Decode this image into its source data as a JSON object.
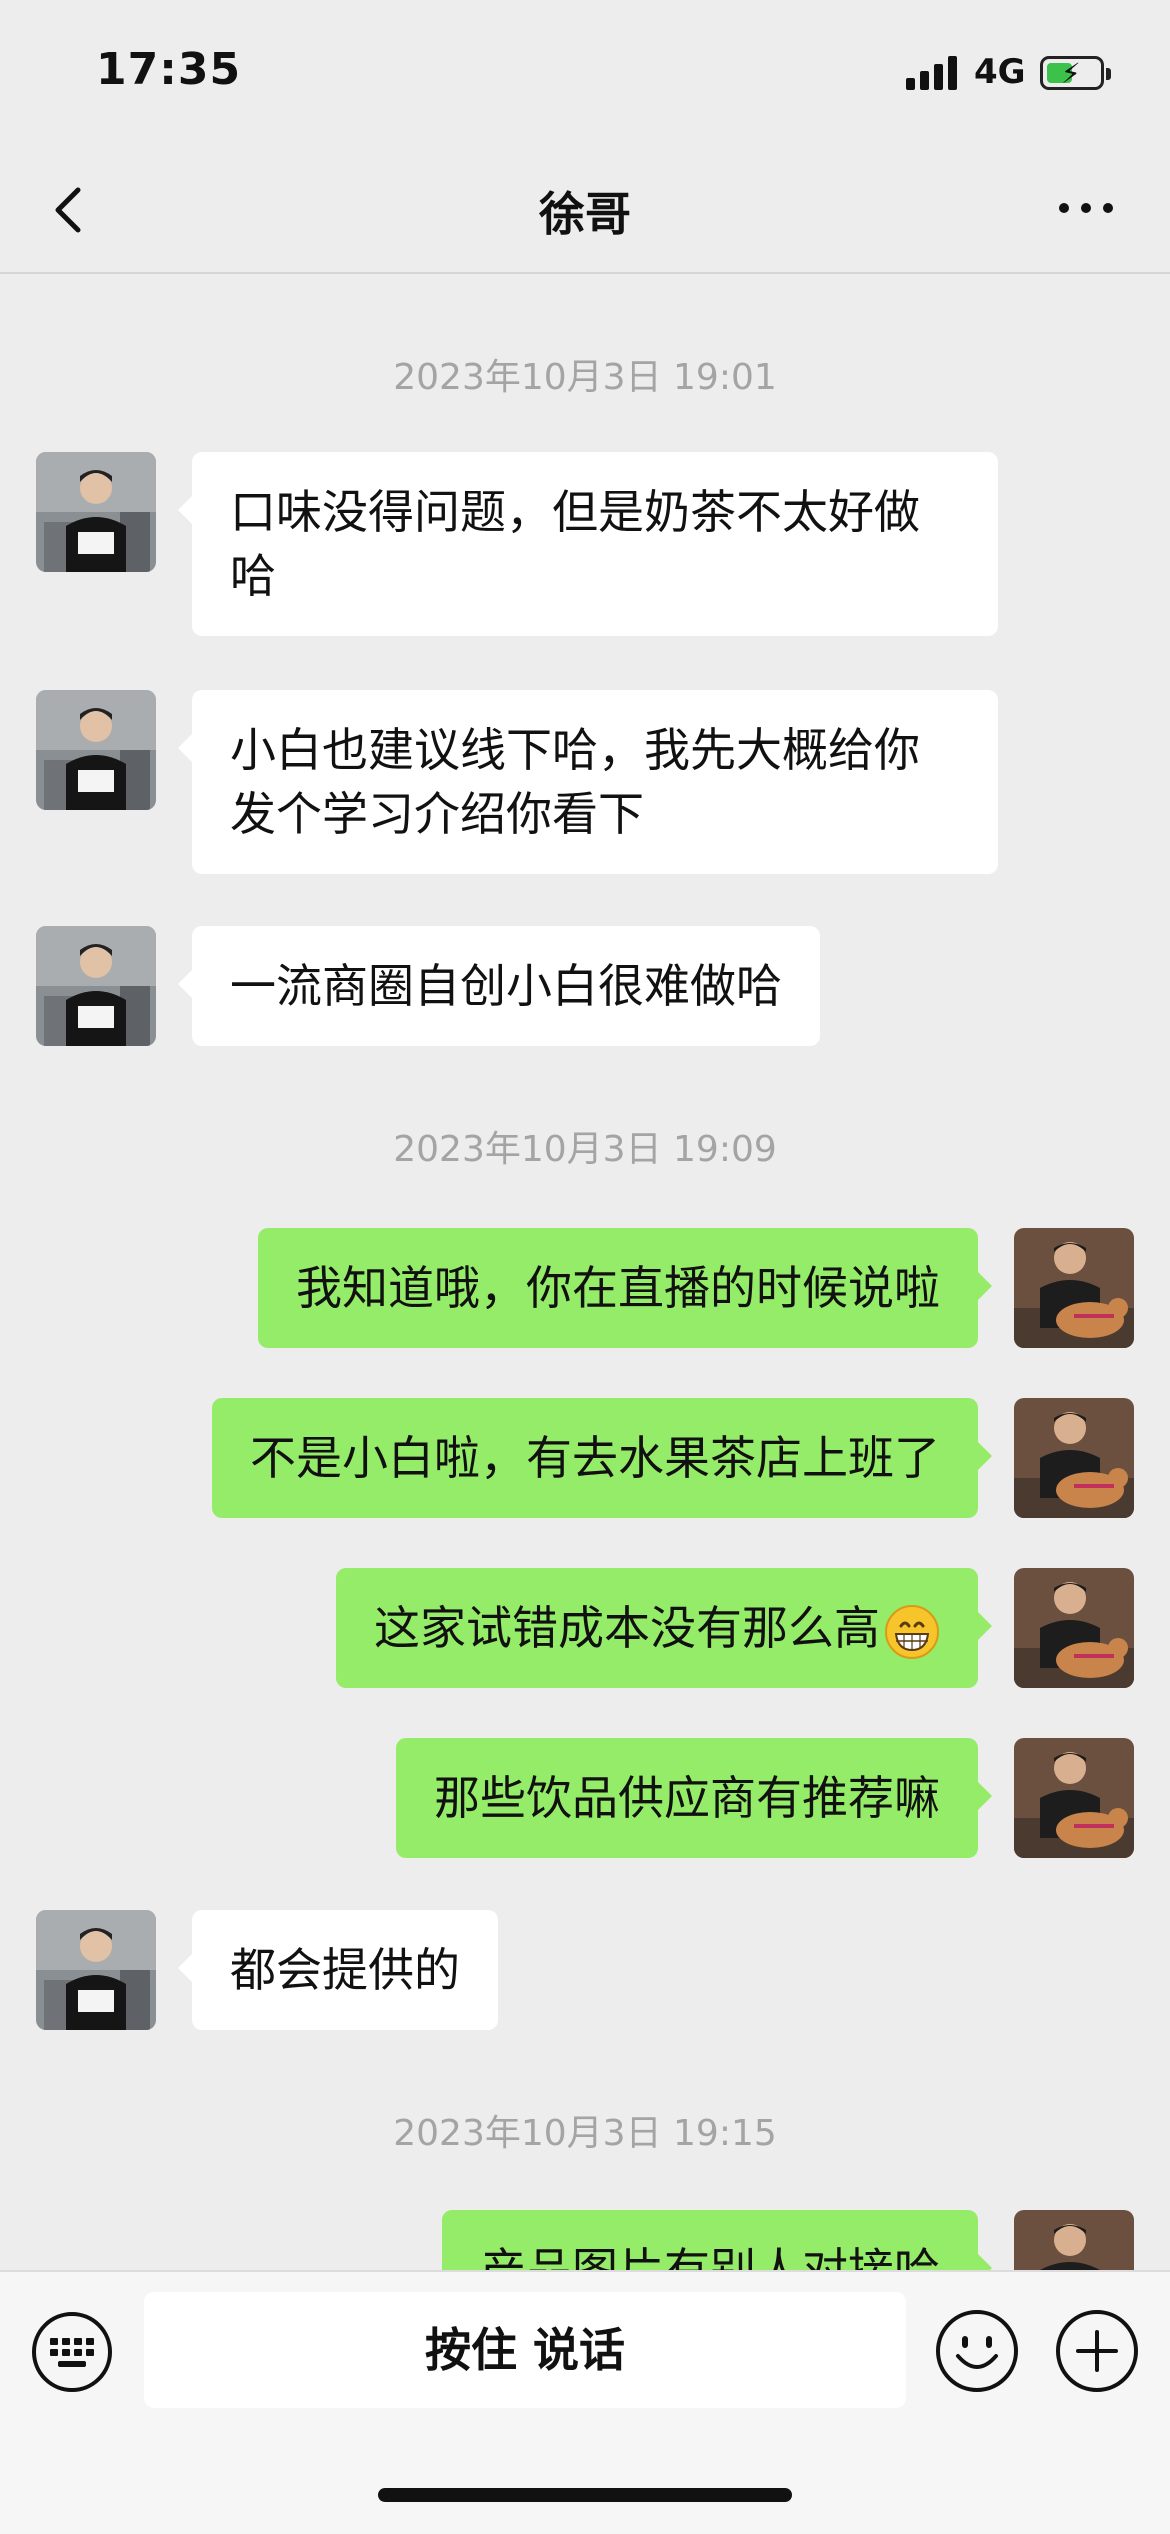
{
  "status_bar": {
    "time": "17:35",
    "network": "4G",
    "battery_level": 0.5
  },
  "header": {
    "title": "徐哥"
  },
  "messages": [
    {
      "type": "timestamp",
      "text": "2023年10月3日 19:01"
    },
    {
      "type": "message",
      "side": "left",
      "text": "口味没得问题，但是奶茶不太好做哈"
    },
    {
      "type": "message",
      "side": "left",
      "text": "小白也建议线下哈，我先大概给你发个学习介绍你看下"
    },
    {
      "type": "message",
      "side": "left",
      "text": "一流商圈自创小白很难做哈"
    },
    {
      "type": "timestamp",
      "text": "2023年10月3日 19:09"
    },
    {
      "type": "message",
      "side": "right",
      "text": "我知道哦，你在直播的时候说啦"
    },
    {
      "type": "message",
      "side": "right",
      "text": "不是小白啦，有去水果茶店上班了"
    },
    {
      "type": "message",
      "side": "right",
      "text": "这家试错成本没有那么高",
      "emoji": "grinning-face-emoji"
    },
    {
      "type": "message",
      "side": "right",
      "text": "那些饮品供应商有推荐嘛"
    },
    {
      "type": "message",
      "side": "left",
      "text": "都会提供的"
    },
    {
      "type": "timestamp",
      "text": "2023年10月3日 19:15"
    },
    {
      "type": "message",
      "side": "right",
      "text": "产品图片有别人对接哈"
    }
  ],
  "input_bar": {
    "voice_button_label": "按住 说话",
    "left_icon": "keyboard-icon",
    "emoji_icon": "smile-icon",
    "more_icon": "plus-icon"
  },
  "colors": {
    "background": "#ededed",
    "bubble_self": "#95ec69",
    "bubble_other": "#ffffff",
    "timestamp": "#a4a4a4"
  }
}
